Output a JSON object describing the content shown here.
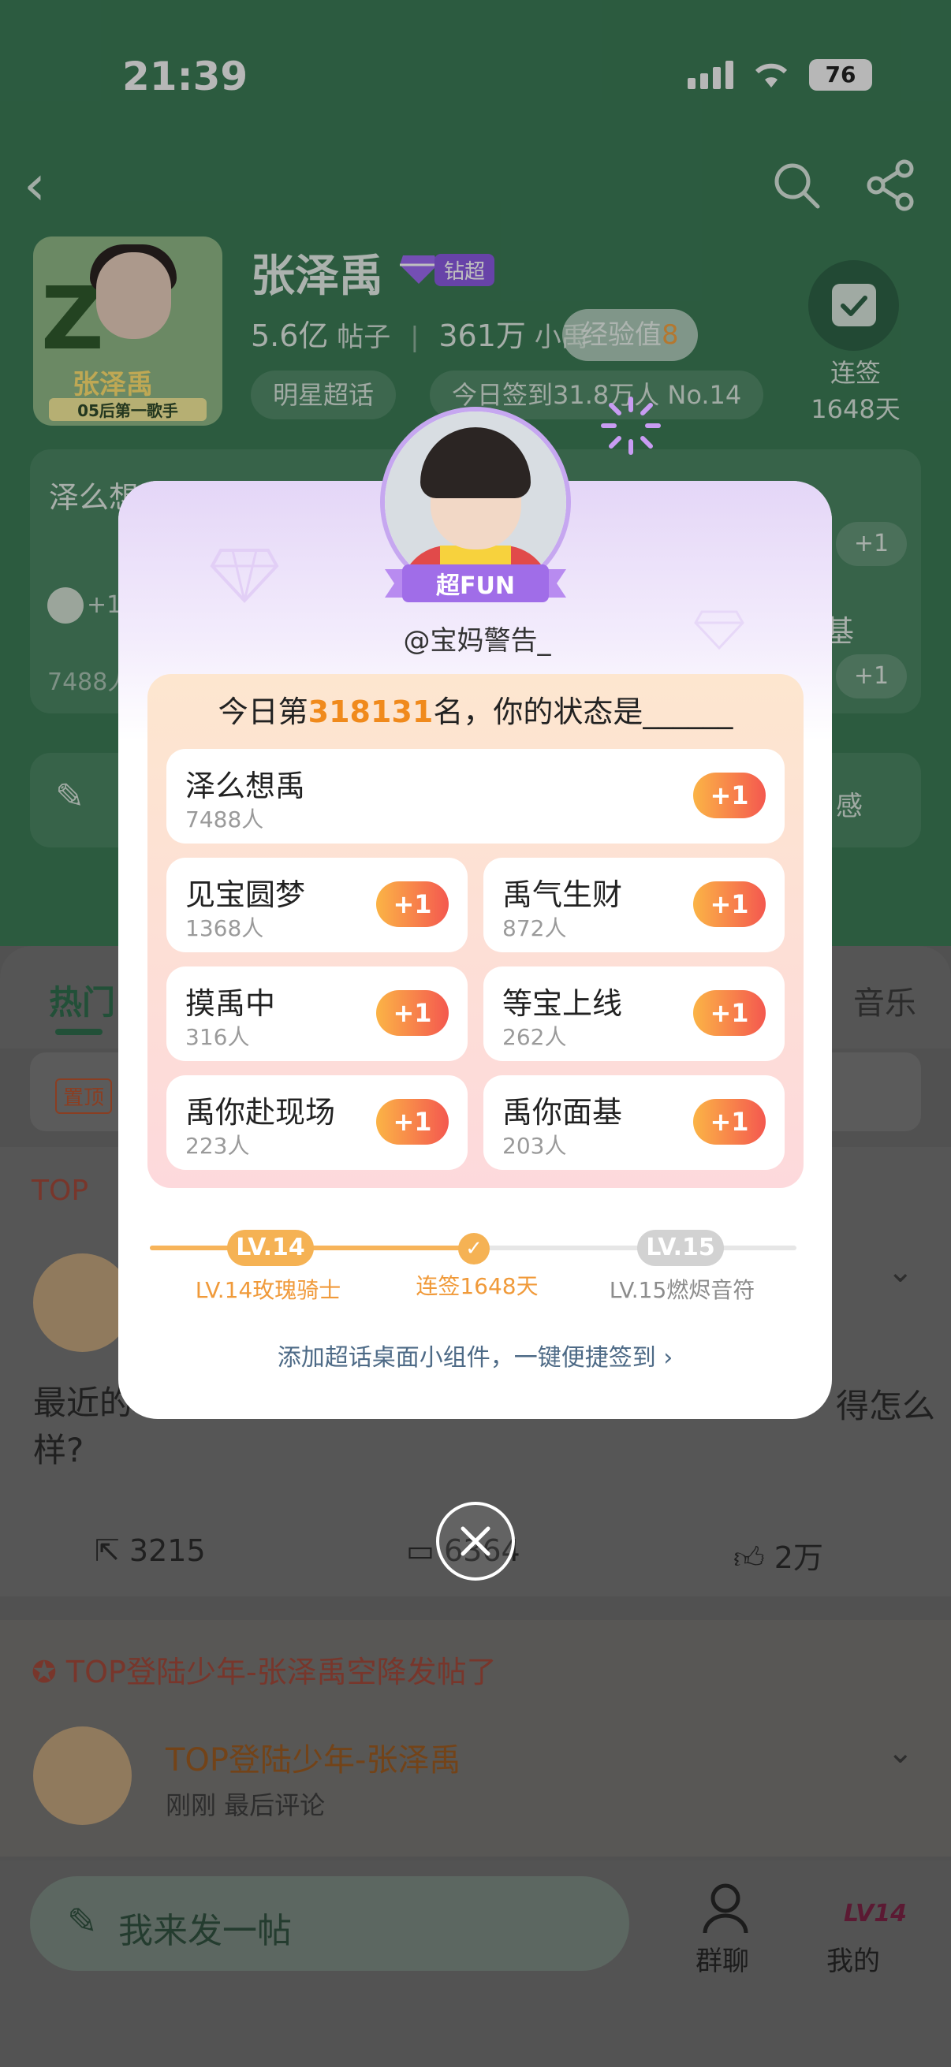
{
  "status_bar": {
    "time": "21:39",
    "battery": "76"
  },
  "community": {
    "name": "张泽禹",
    "badge": "钻超",
    "posts_count": "5.6亿",
    "posts_label": "帖子",
    "members_count": "361万",
    "members_label": "小禹",
    "tag1": "明星超话",
    "tag2": "今日签到31.8万人 No.14",
    "cover_name": "张泽禹",
    "cover_sub": "05后第一歌手",
    "checkin_label": "连签",
    "checkin_days": "1648天"
  },
  "exp_pill": {
    "label": "经验值",
    "value": "8"
  },
  "hot_list": {
    "left_title": "泽么想禹",
    "left_plus": "+1",
    "left_count": "7488人",
    "right_pill": "+1",
    "right_text": "基"
  },
  "post_row": {
    "right_text": "感"
  },
  "tabs": {
    "hot": "热门",
    "music": "音乐"
  },
  "pinned": {
    "tag": "置顶"
  },
  "feed": [
    {
      "top_label": "TOP",
      "text_left": "最近的",
      "text_right": "得怎么",
      "text_line2": "样?",
      "shares": "3215",
      "comments": "6364",
      "likes": "2万"
    },
    {
      "top_label": "TOP登陆少年-张泽禹空降发帖了",
      "author": "TOP登陆少年-张泽禹",
      "meta": "刚刚 最后评论"
    }
  ],
  "bottom": {
    "compose": "我来发一帖",
    "group_chat": "群聊",
    "me": "我的",
    "me_level": "LV14"
  },
  "modal": {
    "ribbon": "超FUN",
    "handle": "@宝妈警告_",
    "rank_prefix": "今日第",
    "rank_number": "318131",
    "rank_suffix": "名，你的状态是______",
    "options": [
      {
        "name": "泽么想禹",
        "count": "7488人",
        "plus": "+1"
      },
      {
        "name": "见宝圆梦",
        "count": "1368人",
        "plus": "+1"
      },
      {
        "name": "禹气生财",
        "count": "872人",
        "plus": "+1"
      },
      {
        "name": "摸禹中",
        "count": "316人",
        "plus": "+1"
      },
      {
        "name": "等宝上线",
        "count": "262人",
        "plus": "+1"
      },
      {
        "name": "禹你赴现场",
        "count": "223人",
        "plus": "+1"
      },
      {
        "name": "禹你面基",
        "count": "203人",
        "plus": "+1"
      }
    ],
    "level_current_pill": "LV.14",
    "level_next_pill": "LV.15",
    "level_current_name": "LV.14玫瑰骑士",
    "streak": "连签1648天",
    "level_next_name": "LV.15燃烬音符",
    "widget_link": "添加超话桌面小组件，一键便捷签到 ›"
  },
  "colors": {
    "accent_orange": "#f08a1c",
    "brand_green": "#3b7a55",
    "purple": "#8a5ae0"
  }
}
